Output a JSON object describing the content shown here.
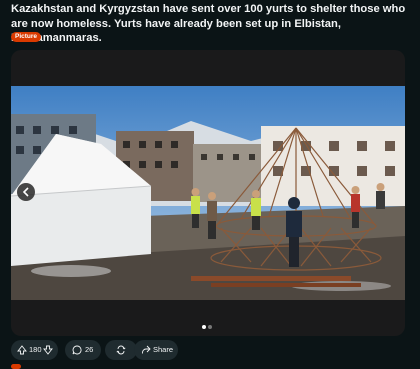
{
  "post": {
    "title": "Kazakhstan and Kyrgyzstan have sent over 100 yurts to shelter those who are now homeless. Yurts have already been set up in Elbistan, Kahramanmaras.",
    "flair": "Picture"
  },
  "gallery": {
    "prev_icon": "chevron-left-icon",
    "page_count": 2,
    "current_page": 1
  },
  "actions": {
    "votes": "180",
    "comments": "26",
    "share_label": "Share"
  },
  "colors": {
    "background": "#0b1416",
    "flair": "#d93a00",
    "pill": "#1f2b2f"
  }
}
